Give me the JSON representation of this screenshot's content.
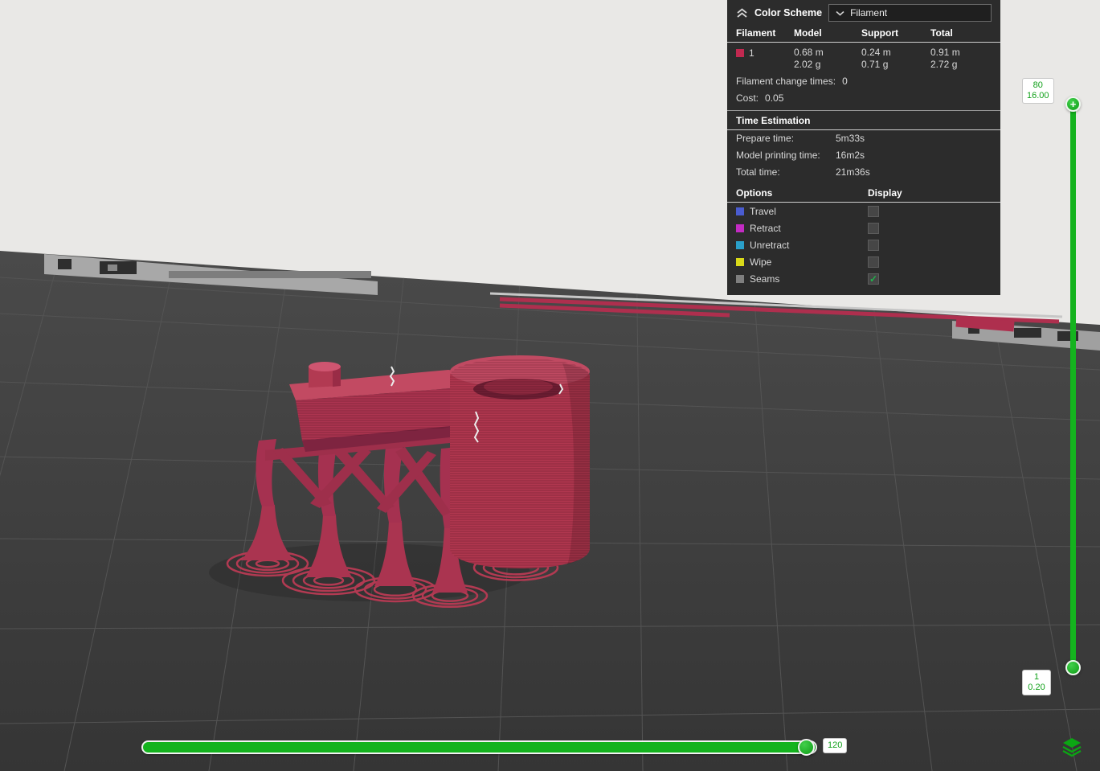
{
  "panel": {
    "title": "Color Scheme",
    "dropdown": {
      "value": "Filament"
    },
    "table": {
      "headers": [
        "Filament",
        "Model",
        "Support",
        "Total"
      ],
      "row": {
        "id": "1",
        "swatch_color": "#c12950",
        "model": [
          "0.68 m",
          "2.02 g"
        ],
        "support": [
          "0.24 m",
          "0.71 g"
        ],
        "total": [
          "0.91 m",
          "2.72 g"
        ]
      }
    },
    "filament_change": {
      "label": "Filament change times:",
      "value": "0"
    },
    "cost": {
      "label": "Cost:",
      "value": "0.05"
    },
    "time_estimation": {
      "title": "Time Estimation",
      "rows": [
        {
          "label": "Prepare time:",
          "value": "5m33s"
        },
        {
          "label": "Model printing time:",
          "value": "16m2s"
        },
        {
          "label": "Total time:",
          "value": "21m36s"
        }
      ]
    },
    "options_header": {
      "options": "Options",
      "display": "Display"
    },
    "options": [
      {
        "label": "Travel",
        "color": "#4a5cd0",
        "check": ""
      },
      {
        "label": "Retract",
        "color": "#c32bc3",
        "check": ""
      },
      {
        "label": "Unretract",
        "color": "#2a9fc9",
        "check": ""
      },
      {
        "label": "Wipe",
        "color": "#d9d919",
        "check": ""
      },
      {
        "label": "Seams",
        "color": "#7f7f7f",
        "check": "✓"
      }
    ]
  },
  "layer_slider": {
    "top": {
      "layer": "80",
      "height": "16.00",
      "plus": "+"
    },
    "bottom": {
      "layer": "1",
      "height": "0.20"
    }
  },
  "step_slider": {
    "value": "120"
  },
  "colors": {
    "accent_green": "#14b31e",
    "model_red": "#b23a52",
    "badge_text": "#12a11b",
    "plate": "#3c3c3c"
  }
}
